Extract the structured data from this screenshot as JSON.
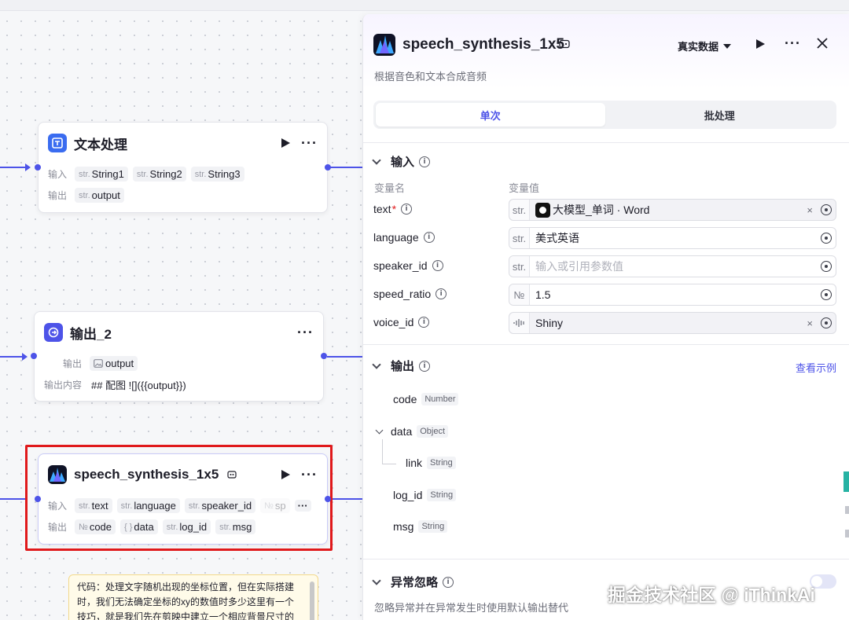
{
  "canvas": {
    "node_text": {
      "title": "文本处理",
      "input_label": "输入",
      "output_label": "输出",
      "inputs": [
        {
          "type": "str.",
          "name": "String1"
        },
        {
          "type": "str.",
          "name": "String2"
        },
        {
          "type": "str.",
          "name": "String3"
        }
      ],
      "outputs": [
        {
          "type": "str.",
          "name": "output"
        }
      ]
    },
    "node_output2": {
      "title": "输出_2",
      "output_label": "输出",
      "output_var": "output",
      "content_label": "输出内容",
      "content_value": "## 配图 ![]({{output}})"
    },
    "node_speech": {
      "title": "speech_synthesis_1x5",
      "input_label": "输入",
      "output_label": "输出",
      "inputs": [
        {
          "type": "str.",
          "name": "text"
        },
        {
          "type": "str.",
          "name": "language"
        },
        {
          "type": "str.",
          "name": "speaker_id"
        },
        {
          "type": "№",
          "name": "sp"
        }
      ],
      "outputs": [
        {
          "type": "№",
          "name": "code"
        },
        {
          "type": "{ }",
          "name": "data"
        },
        {
          "type": "str.",
          "name": "log_id"
        },
        {
          "type": "str.",
          "name": "msg"
        }
      ]
    },
    "comment": {
      "lines": [
        "代码：处理文字随机出现的坐标位置，但在实际搭建",
        "时，我们无法确定坐标的xy的数值时多少这里有一个",
        "技巧，就是我们先在剪映中建立一个相应背景尺寸的"
      ]
    }
  },
  "panel": {
    "title": "speech_synthesis_1x5",
    "subtitle": "根据音色和文本合成音频",
    "mode": "真实数据",
    "tabs": [
      {
        "label": "单次",
        "active": true
      },
      {
        "label": "批处理",
        "active": false
      }
    ],
    "input_section": {
      "title": "输入",
      "col_name": "变量名",
      "col_value": "变量值",
      "params": [
        {
          "name": "text",
          "required": true,
          "type": "str.",
          "value": "大模型_单词 · Word",
          "is_ref": true
        },
        {
          "name": "language",
          "required": false,
          "type": "str.",
          "value": "美式英语",
          "is_ref": false
        },
        {
          "name": "speaker_id",
          "required": false,
          "type": "str.",
          "placeholder": "输入或引用参数值",
          "is_ref": false
        },
        {
          "name": "speed_ratio",
          "required": false,
          "type": "№",
          "value": "1.5",
          "is_ref": false
        },
        {
          "name": "voice_id",
          "required": false,
          "type": "wave",
          "value": "Shiny",
          "is_ref": true
        }
      ]
    },
    "output_section": {
      "title": "输出",
      "example_link": "查看示例",
      "fields": [
        {
          "name": "code",
          "type": "Number"
        },
        {
          "name": "data",
          "type": "Object"
        },
        {
          "name": "link",
          "type": "String"
        },
        {
          "name": "log_id",
          "type": "String"
        },
        {
          "name": "msg",
          "type": "String"
        }
      ]
    },
    "exception_section": {
      "title": "异常忽略",
      "description": "忽略异常并在异常发生时使用默认输出替代"
    }
  },
  "watermark": "掘金技术社区 @ iThinkAi",
  "colors": {
    "accent": "#4d53e8",
    "highlight": "#e0191b",
    "required": "#e0191b"
  }
}
